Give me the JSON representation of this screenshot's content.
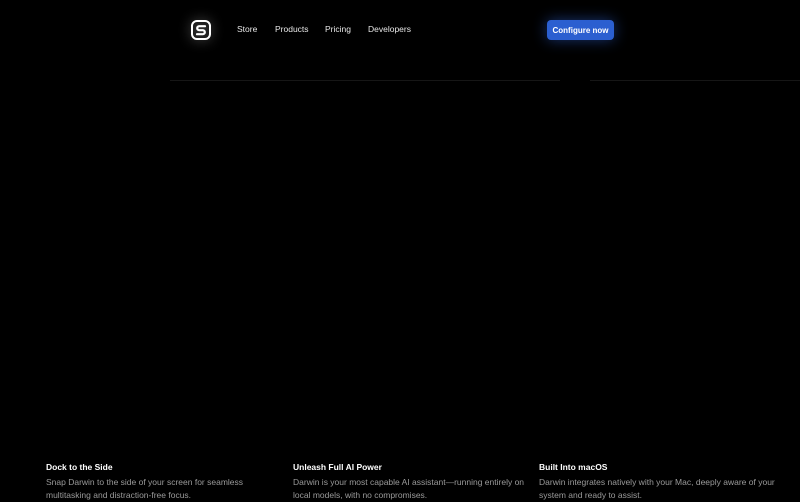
{
  "nav": {
    "logo_icon": "s-logo-icon",
    "links": [
      "Store",
      "Products",
      "Pricing",
      "Developers"
    ],
    "cta_label": "Configure now"
  },
  "colors": {
    "background": "#000000",
    "accent": "#2b5fd0",
    "muted_text": "#9a9a9a"
  },
  "features": [
    {
      "title": "Dock to the Side",
      "desc": "Snap Darwin to the side of your screen for seamless multitasking and distraction-free focus."
    },
    {
      "title": "Unleash Full AI Power",
      "desc": "Darwin is your most capable AI assistant—running entirely on local models, with no compromises."
    },
    {
      "title": "Built Into macOS",
      "desc": "Darwin integrates natively with your Mac, deeply aware of your system and ready to assist."
    }
  ]
}
